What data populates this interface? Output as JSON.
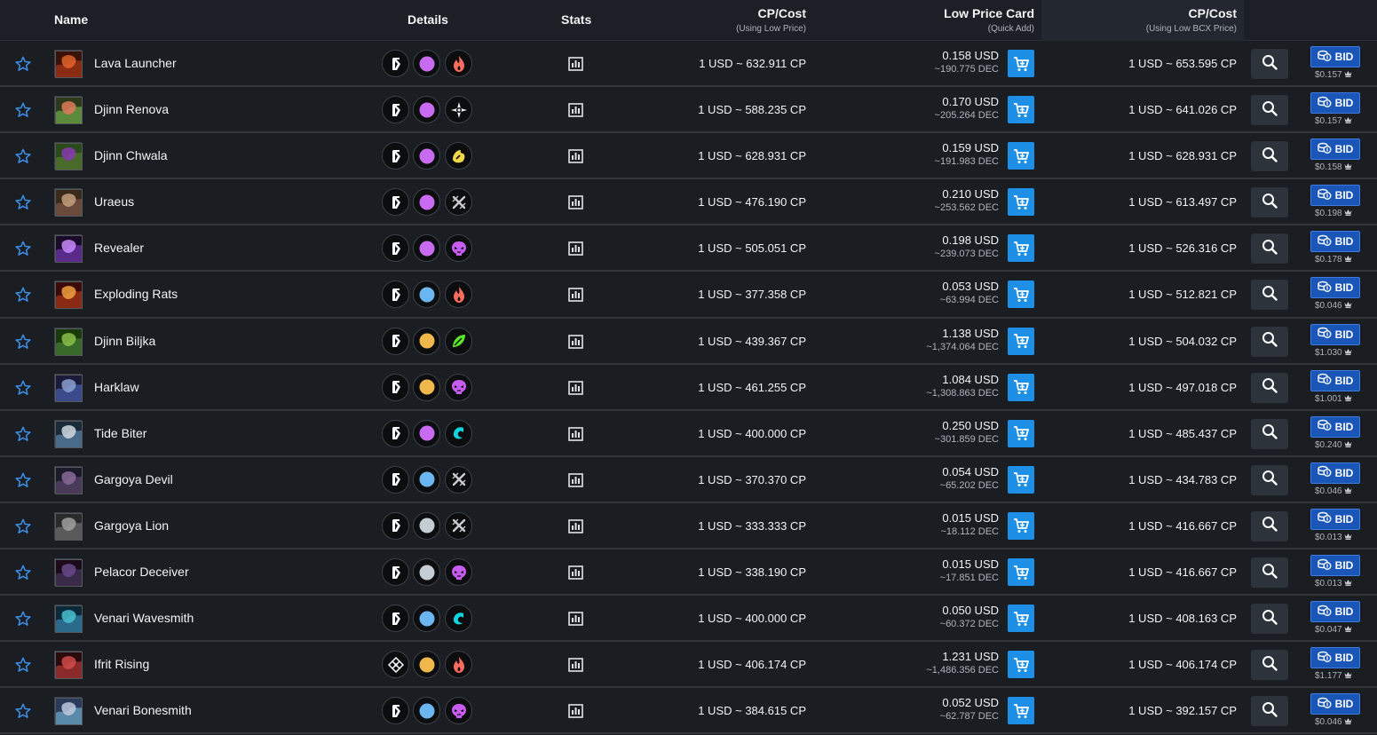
{
  "header": {
    "name": "Name",
    "details": "Details",
    "stats": "Stats",
    "cp_cost": "CP/Cost",
    "cp_cost_sub": "(Using Low Price)",
    "low_price": "Low Price Card",
    "low_price_sub": "(Quick Add)",
    "cp_cost2": "CP/Cost",
    "cp_cost2_sub": "(Using Low BCX Price)"
  },
  "bid_label": "BID",
  "colors": {
    "purple": "#c86bf0",
    "blue": "#6bb6f0",
    "gold": "#f0b84a",
    "gray": "#c4ccd4",
    "fire": "#ff6b5c",
    "water": "#12d4e0",
    "earth": "#5ce62a",
    "death": "#c85cf0",
    "neutral": "#cccccc",
    "life": "#f0d84a"
  },
  "rows": [
    {
      "name": "Lava Launcher",
      "rarity": "purple",
      "element": "fire-icon",
      "edition": "untamed-icon",
      "cp_low": "1 USD ~ 632.911 CP",
      "low_usd": "0.158 USD",
      "low_dec": "~190.775 DEC",
      "cp_bcx": "1 USD ~ 653.595 CP",
      "bid_price": "$0.157"
    },
    {
      "name": "Djinn Renova",
      "rarity": "purple",
      "element": "life-icon",
      "edition": "untamed-icon",
      "cp_low": "1 USD ~ 588.235 CP",
      "low_usd": "0.170 USD",
      "low_dec": "~205.264 DEC",
      "cp_bcx": "1 USD ~ 641.026 CP",
      "bid_price": "$0.157"
    },
    {
      "name": "Djinn Chwala",
      "rarity": "purple",
      "element": "dragon-icon",
      "edition": "untamed-icon",
      "cp_low": "1 USD ~ 628.931 CP",
      "low_usd": "0.159 USD",
      "low_dec": "~191.983 DEC",
      "cp_bcx": "1 USD ~ 628.931 CP",
      "bid_price": "$0.158"
    },
    {
      "name": "Uraeus",
      "rarity": "purple",
      "element": "neutral-icon",
      "edition": "untamed-icon",
      "cp_low": "1 USD ~ 476.190 CP",
      "low_usd": "0.210 USD",
      "low_dec": "~253.562 DEC",
      "cp_bcx": "1 USD ~ 613.497 CP",
      "bid_price": "$0.198"
    },
    {
      "name": "Revealer",
      "rarity": "purple",
      "element": "death-icon",
      "edition": "untamed-icon",
      "cp_low": "1 USD ~ 505.051 CP",
      "low_usd": "0.198 USD",
      "low_dec": "~239.073 DEC",
      "cp_bcx": "1 USD ~ 526.316 CP",
      "bid_price": "$0.178"
    },
    {
      "name": "Exploding Rats",
      "rarity": "blue",
      "element": "fire-icon",
      "edition": "untamed-icon",
      "cp_low": "1 USD ~ 377.358 CP",
      "low_usd": "0.053 USD",
      "low_dec": "~63.994 DEC",
      "cp_bcx": "1 USD ~ 512.821 CP",
      "bid_price": "$0.046"
    },
    {
      "name": "Djinn Biljka",
      "rarity": "gold",
      "element": "earth-icon",
      "edition": "untamed-icon",
      "cp_low": "1 USD ~ 439.367 CP",
      "low_usd": "1.138 USD",
      "low_dec": "~1,374.064 DEC",
      "cp_bcx": "1 USD ~ 504.032 CP",
      "bid_price": "$1.030"
    },
    {
      "name": "Harklaw",
      "rarity": "gold",
      "element": "death-icon",
      "edition": "untamed-icon",
      "cp_low": "1 USD ~ 461.255 CP",
      "low_usd": "1.084 USD",
      "low_dec": "~1,308.863 DEC",
      "cp_bcx": "1 USD ~ 497.018 CP",
      "bid_price": "$1.001"
    },
    {
      "name": "Tide Biter",
      "rarity": "purple",
      "element": "water-icon",
      "edition": "untamed-icon",
      "cp_low": "1 USD ~ 400.000 CP",
      "low_usd": "0.250 USD",
      "low_dec": "~301.859 DEC",
      "cp_bcx": "1 USD ~ 485.437 CP",
      "bid_price": "$0.240"
    },
    {
      "name": "Gargoya Devil",
      "rarity": "blue",
      "element": "neutral-icon",
      "edition": "untamed-icon",
      "cp_low": "1 USD ~ 370.370 CP",
      "low_usd": "0.054 USD",
      "low_dec": "~65.202 DEC",
      "cp_bcx": "1 USD ~ 434.783 CP",
      "bid_price": "$0.046"
    },
    {
      "name": "Gargoya Lion",
      "rarity": "gray",
      "element": "neutral-icon",
      "edition": "untamed-icon",
      "cp_low": "1 USD ~ 333.333 CP",
      "low_usd": "0.015 USD",
      "low_dec": "~18.112 DEC",
      "cp_bcx": "1 USD ~ 416.667 CP",
      "bid_price": "$0.013"
    },
    {
      "name": "Pelacor Deceiver",
      "rarity": "gray",
      "element": "death-icon",
      "edition": "untamed-icon",
      "cp_low": "1 USD ~ 338.190 CP",
      "low_usd": "0.015 USD",
      "low_dec": "~17.851 DEC",
      "cp_bcx": "1 USD ~ 416.667 CP",
      "bid_price": "$0.013"
    },
    {
      "name": "Venari Wavesmith",
      "rarity": "blue",
      "element": "water-icon",
      "edition": "untamed-icon",
      "cp_low": "1 USD ~ 400.000 CP",
      "low_usd": "0.050 USD",
      "low_dec": "~60.372 DEC",
      "cp_bcx": "1 USD ~ 408.163 CP",
      "bid_price": "$0.047"
    },
    {
      "name": "Ifrit Rising",
      "rarity": "gold",
      "element": "fire-icon",
      "edition": "diamond-icon",
      "cp_low": "1 USD ~ 406.174 CP",
      "low_usd": "1.231 USD",
      "low_dec": "~1,486.356 DEC",
      "cp_bcx": "1 USD ~ 406.174 CP",
      "bid_price": "$1.177"
    },
    {
      "name": "Venari Bonesmith",
      "rarity": "blue",
      "element": "death-icon",
      "edition": "untamed-icon",
      "cp_low": "1 USD ~ 384.615 CP",
      "low_usd": "0.052 USD",
      "low_dec": "~62.787 DEC",
      "cp_bcx": "1 USD ~ 392.157 CP",
      "bid_price": "$0.046"
    }
  ]
}
